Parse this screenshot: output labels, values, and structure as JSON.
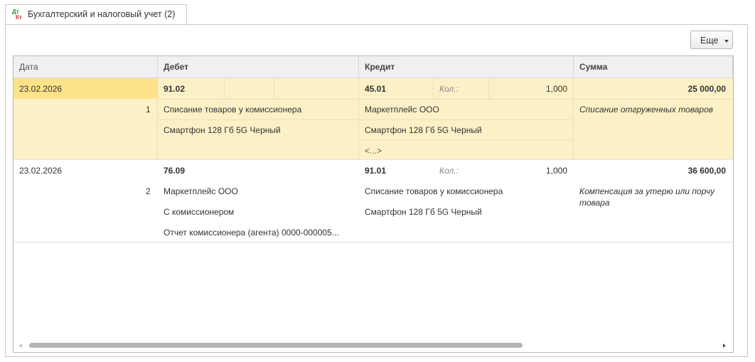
{
  "tab": {
    "label": "Бухгалтерский и налоговый учет (2)",
    "icon": "dt-kt-icon",
    "icon_dt": "Дт",
    "icon_kt": "Кт"
  },
  "toolbar": {
    "more_label": "Еще"
  },
  "grid": {
    "columns": [
      "Дата",
      "Дебет",
      "Кредит",
      "Сумма"
    ],
    "rows": [
      {
        "date": "23.02.2026",
        "number": "1",
        "debit_account": "91.02",
        "debit_sub": [
          "Списание товаров у комиссионера",
          "Смартфон 128 Гб 5G Черный"
        ],
        "credit_account": "45.01",
        "qty_label": "Кол.:",
        "qty": "1,000",
        "credit_sub": [
          "Маркетплейс ООО",
          "Смартфон 128 Гб 5G Черный",
          "<...>"
        ],
        "amount": "25 000,00",
        "content": "Списание отгруженных товаров"
      },
      {
        "date": "23.02.2026",
        "number": "2",
        "debit_account": "76.09",
        "debit_sub": [
          "Маркетплейс ООО",
          "С комиссионером",
          "Отчет комиссионера (агента) 0000-000005..."
        ],
        "credit_account": "91.01",
        "qty_label": "Кол.:",
        "qty": "1,000",
        "credit_sub": [
          "Списание товаров у комиссионера",
          "Смартфон 128 Гб 5G Черный"
        ],
        "amount": "36 600,00",
        "content_line1": "Компенсация за утерю или порчу",
        "content_line2": "товара"
      }
    ]
  },
  "colors": {
    "selected_row_bg": "#fcf1c6",
    "selected_cell_bg": "#fde28a",
    "header_bg": "#f0f0f0"
  }
}
